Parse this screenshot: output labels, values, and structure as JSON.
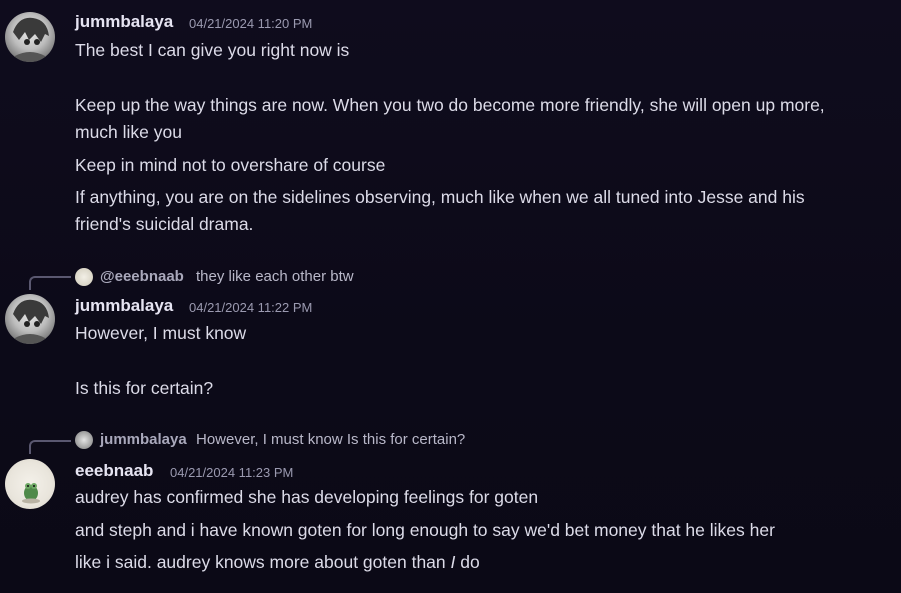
{
  "messages": [
    {
      "username": "jummbalaya",
      "timestamp": "04/21/2024 11:20 PM",
      "lines": [
        "The best I can give you right now is",
        "Keep up the way things are now. When you two do become more friendly, she will open up more,",
        "much like you",
        "Keep in mind not to overshare of course",
        "If anything, you are on the sidelines observing, much like when we all tuned into Jesse and his",
        "friend's suicidal drama."
      ]
    },
    {
      "reply_to": {
        "name": "@eeebnaab",
        "text": "they like each other btw"
      },
      "username": "jummbalaya",
      "timestamp": "04/21/2024 11:22 PM",
      "lines": [
        "However, I must know",
        "Is this for certain?"
      ]
    },
    {
      "reply_to": {
        "name": "jummbalaya",
        "text": "However, I must know  Is this for certain?"
      },
      "username": "eeebnaab",
      "timestamp": "04/21/2024 11:23 PM",
      "lines": [
        "audrey has confirmed she has developing feelings for goten",
        "and steph and i have known goten for long enough to say we'd bet money that he likes her",
        "like i said. audrey knows more about goten than",
        "do"
      ],
      "emphasis": "I"
    }
  ]
}
